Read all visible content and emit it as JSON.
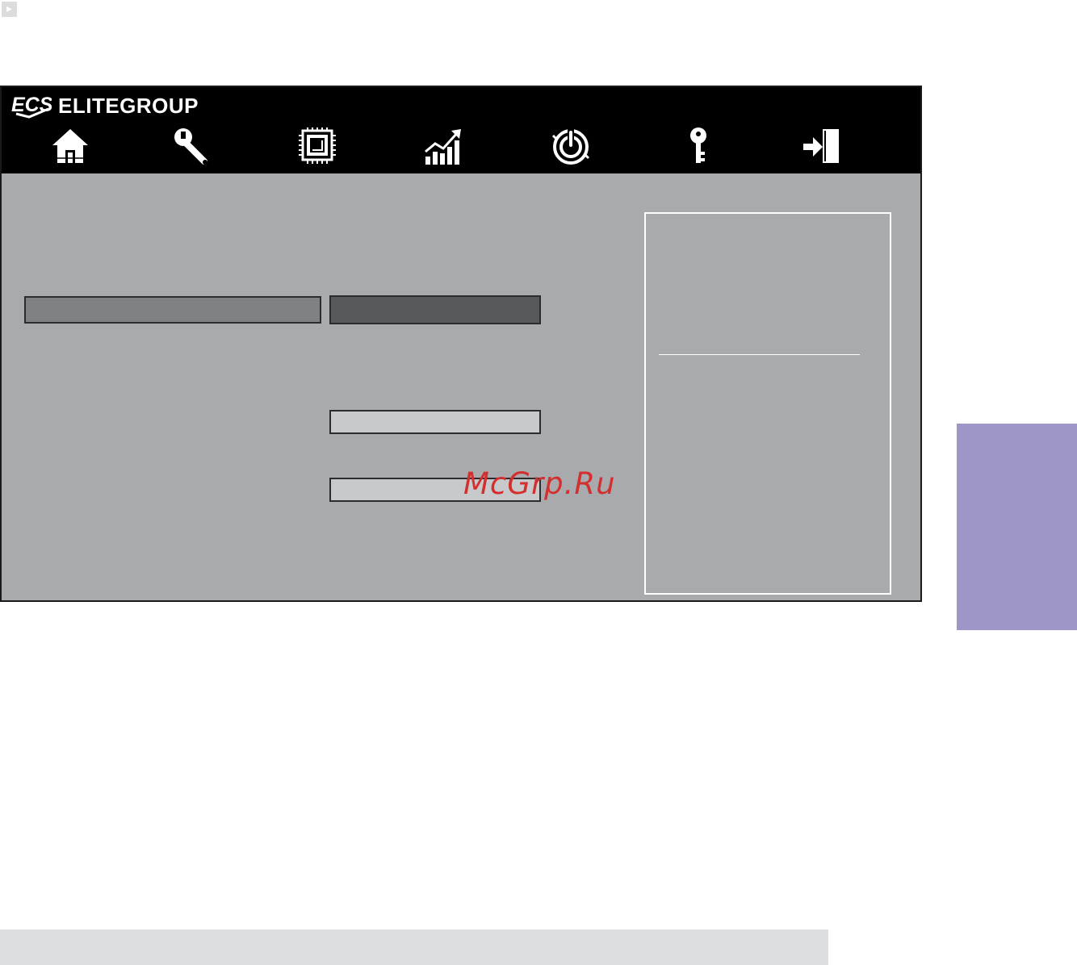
{
  "header": {
    "brand_name": "ELITEGROUP",
    "brand_logo": "ecs-logo"
  },
  "nav": {
    "items": [
      {
        "icon": "home-icon"
      },
      {
        "icon": "wrench-icon"
      },
      {
        "icon": "chip-icon"
      },
      {
        "icon": "performance-chart-icon"
      },
      {
        "icon": "power-icon"
      },
      {
        "icon": "key-icon"
      },
      {
        "icon": "exit-icon"
      }
    ]
  },
  "watermark": {
    "text": "McGrp.Ru"
  },
  "colors": {
    "frame_bg": "#a9aaad",
    "topbar_bg": "#000000",
    "selected_row": "#808184",
    "selected_value": "#58595b",
    "value_field": "#c8c9cb",
    "side_tab": "#9e96c9",
    "watermark": "#d32f2f"
  }
}
